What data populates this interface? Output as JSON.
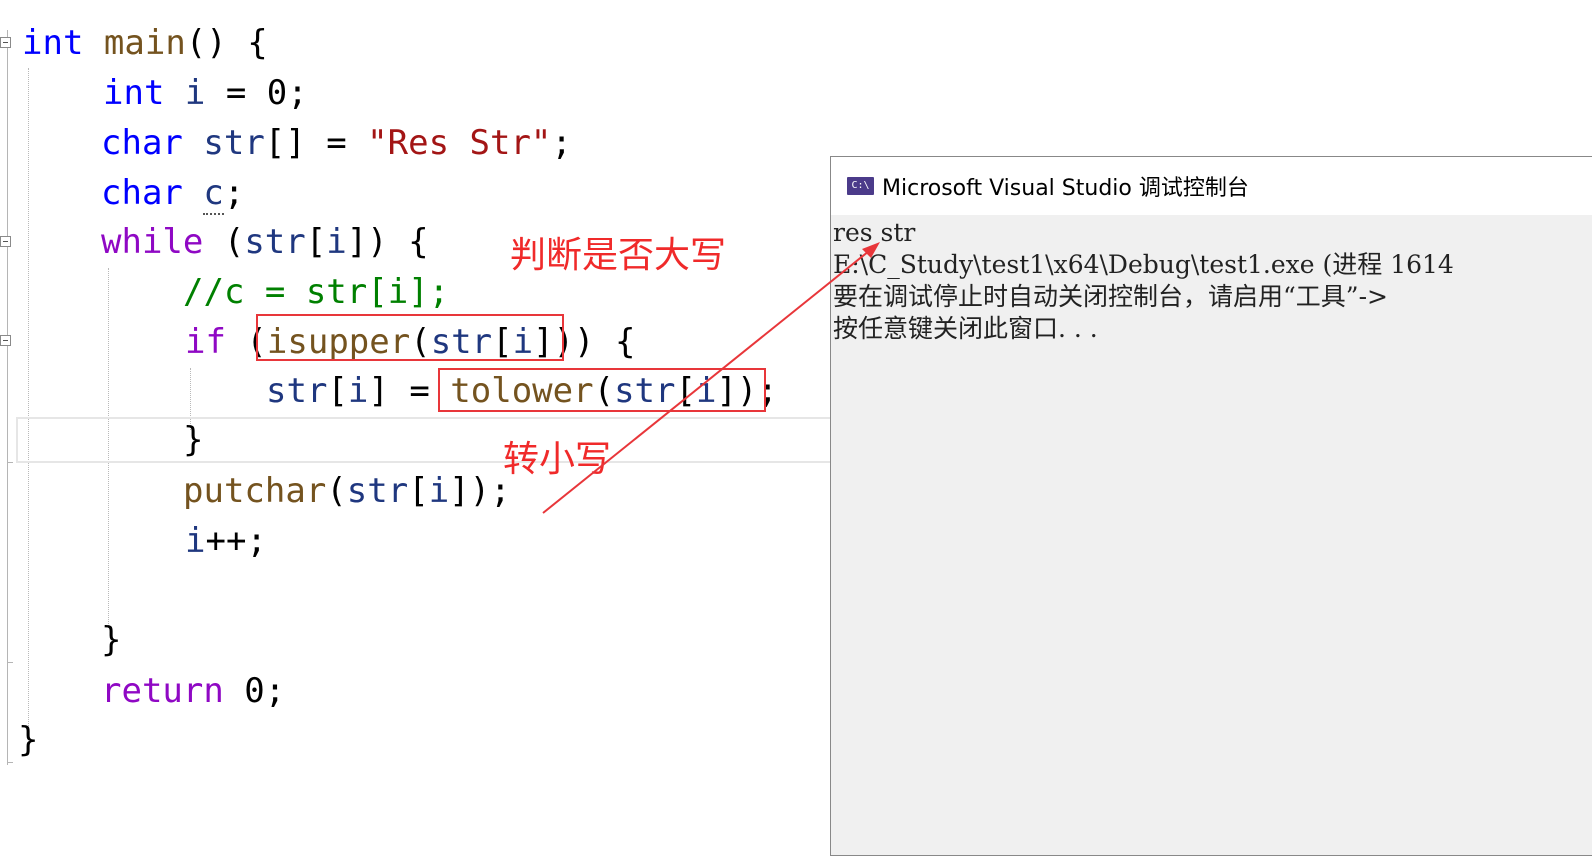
{
  "code": {
    "line1": {
      "kw": "int",
      "fn": "main",
      "rest": "() {"
    },
    "line2": {
      "kw": "int",
      "var": "i",
      "rest": " = 0;"
    },
    "line3": {
      "kw": "char",
      "var": "str",
      "rest1": "[] = ",
      "str": "\"Res Str\"",
      "rest2": ";"
    },
    "line4": {
      "kw": "char",
      "var": "c",
      "rest": ";"
    },
    "line5": {
      "kw": "while",
      "rest1": " (",
      "var1": "str",
      "rest2": "[",
      "var2": "i",
      "rest3": "]) {"
    },
    "line6": {
      "comment": "//c = str[i];"
    },
    "line7": {
      "kw": "if",
      "rest1": " (",
      "fn": "isupper",
      "rest2": "(",
      "var1": "str",
      "rest3": "[",
      "var2": "i",
      "rest4": "])) {"
    },
    "line8": {
      "var1": "str",
      "rest1": "[",
      "var2": "i",
      "rest2": "] = ",
      "fn": "tolower",
      "rest3": "(",
      "var3": "str",
      "rest4": "[",
      "var4": "i",
      "rest5": "]);"
    },
    "line9": {
      "rest": "}"
    },
    "line10": {
      "fn": "putchar",
      "rest1": "(",
      "var1": "str",
      "rest2": "[",
      "var2": "i",
      "rest3": "]);"
    },
    "line11": {
      "var": "i",
      "rest": "++;"
    },
    "line12": {
      "rest": "}"
    },
    "line13": {
      "kw": "return",
      "rest": " 0;"
    },
    "line14": {
      "rest": "}"
    }
  },
  "annotations": {
    "check_upper": "判断是否大写",
    "to_lower": "转小写"
  },
  "console": {
    "icon_text": "C:\\",
    "title": "Microsoft Visual Studio 调试控制台",
    "output": [
      "res str",
      "E:\\C_Study\\test1\\x64\\Debug\\test1.exe (进程 1614",
      "要在调试停止时自动关闭控制台，请启用“工具”->",
      "按任意键关闭此窗口. . ."
    ]
  },
  "colors": {
    "keyword": "#0000ff",
    "control_keyword": "#8f08c4",
    "function": "#74531f",
    "variable": "#1f377f",
    "string": "#a31515",
    "comment": "#008000",
    "annotation": "#e8363a"
  }
}
